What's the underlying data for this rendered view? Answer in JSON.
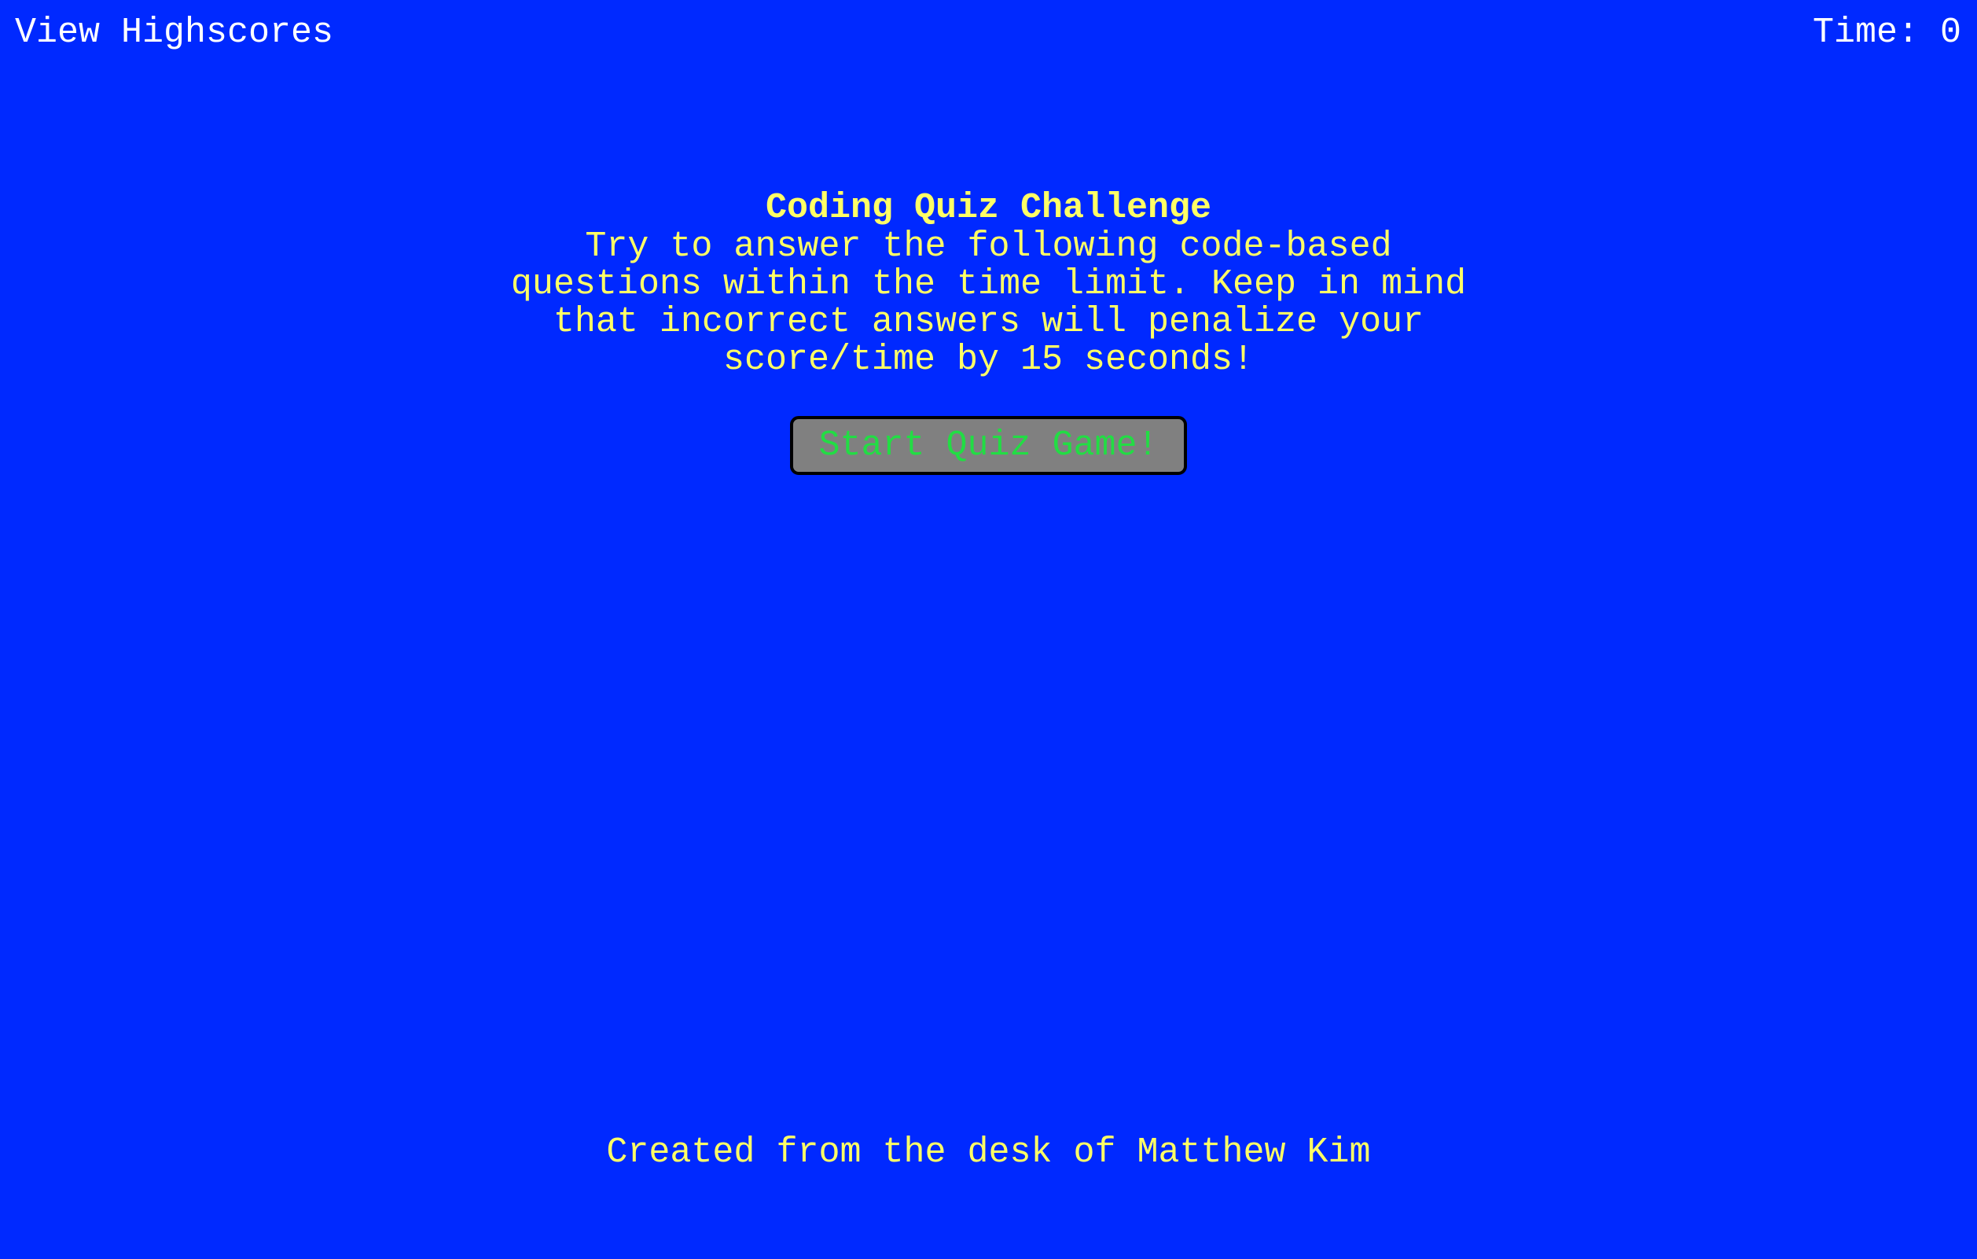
{
  "header": {
    "highscores_link": "View Highscores",
    "timer_label": "Time:",
    "timer_value": "0"
  },
  "intro": {
    "title": "Coding Quiz Challenge",
    "description": "Try to answer the following code-based questions within the time limit. Keep in mind that incorrect answers will penalize your score/time by 15 seconds!",
    "start_button": "Start Quiz Game!"
  },
  "footer": {
    "credit": "Created from the desk of Matthew Kim"
  },
  "colors": {
    "background": "#0029ff",
    "heading_text": "#ffff66",
    "header_text": "#ffffff",
    "button_background": "#808080",
    "button_text": "#22dd44"
  }
}
